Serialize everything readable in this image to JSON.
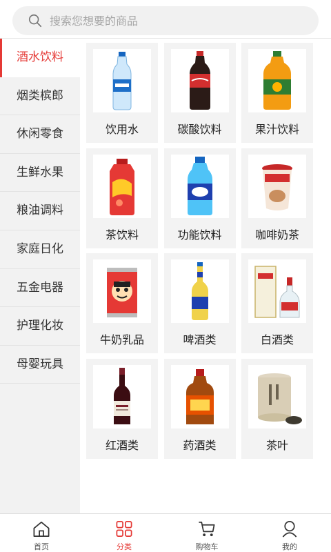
{
  "search": {
    "placeholder": "搜索您想要的商品"
  },
  "sidebar": {
    "items": [
      {
        "label": "酒水饮料"
      },
      {
        "label": "烟类槟郎"
      },
      {
        "label": "休闲零食"
      },
      {
        "label": "生鲜水果"
      },
      {
        "label": "粮油调料"
      },
      {
        "label": "家庭日化"
      },
      {
        "label": "五金电器"
      },
      {
        "label": "护理化妆"
      },
      {
        "label": "母婴玩具"
      }
    ]
  },
  "grid": {
    "items": [
      {
        "label": "饮用水",
        "icon": "water-bottle-icon"
      },
      {
        "label": "碳酸饮料",
        "icon": "cola-bottle-icon"
      },
      {
        "label": "果汁饮料",
        "icon": "juice-bottle-icon"
      },
      {
        "label": "茶饮料",
        "icon": "tea-drink-bottle-icon"
      },
      {
        "label": "功能饮料",
        "icon": "sports-drink-bottle-icon"
      },
      {
        "label": "咖啡奶茶",
        "icon": "milk-tea-cup-icon"
      },
      {
        "label": "牛奶乳品",
        "icon": "milk-can-icon"
      },
      {
        "label": "啤酒类",
        "icon": "beer-bottle-icon"
      },
      {
        "label": "白酒类",
        "icon": "baijiu-bottle-icon"
      },
      {
        "label": "红酒类",
        "icon": "wine-bottle-icon"
      },
      {
        "label": "药酒类",
        "icon": "medicinal-liquor-bottle-icon"
      },
      {
        "label": "茶叶",
        "icon": "tea-leaf-can-icon"
      }
    ]
  },
  "tabbar": {
    "tabs": [
      {
        "label": "首页",
        "icon": "home-icon"
      },
      {
        "label": "分类",
        "icon": "category-icon"
      },
      {
        "label": "购物车",
        "icon": "cart-icon"
      },
      {
        "label": "我的",
        "icon": "user-icon"
      }
    ]
  },
  "colors": {
    "accent": "#e53935",
    "sidebar_bg": "#f2f2f2",
    "cell_bg": "#f3f3f3"
  }
}
